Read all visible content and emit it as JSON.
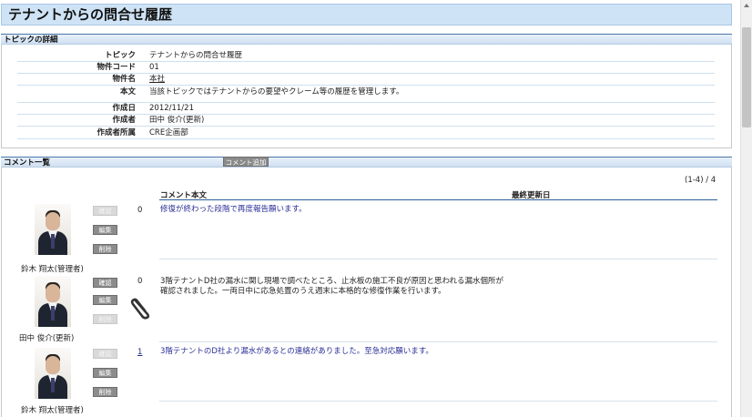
{
  "page_title": "テナントからの問合せ履歴",
  "detail_section": {
    "header": "トピックの詳細",
    "rows": [
      {
        "label": "トピック",
        "value": "テナントからの問合せ履歴"
      },
      {
        "label": "物件コード",
        "value": "01"
      },
      {
        "label": "物件名",
        "value": "本社"
      },
      {
        "label": "本文",
        "value": "当該トピックではテナントからの要望やクレーム等の履歴を管理します。"
      },
      {
        "label": "作成日",
        "value": "2012/11/21"
      },
      {
        "label": "作成者",
        "value": "田中 俊介(更新)"
      },
      {
        "label": "作成者所属",
        "value": "CRE企画部"
      }
    ]
  },
  "comments_section": {
    "header": "コメント一覧",
    "add_button": "コメント追加",
    "count_text": "(1-4) / 4",
    "col_comment": "コメント本文",
    "col_updated": "最終更新日",
    "comments": [
      {
        "author": "鈴木 翔太(管理者)",
        "confirm_label": "確認",
        "edit_label": "編集",
        "delete_label": "削除",
        "count": "0",
        "text": "修復が終わった段階で再度報告願います。"
      },
      {
        "author": "田中 俊介(更新)",
        "confirm_label": "確認",
        "edit_label": "編集",
        "delete_label": "削除",
        "count": "0",
        "text_line1": "3階テナントD社の漏水に関し現場で調べたところ、止水板の施工不良が原因と思われる漏水個所が",
        "text_line2": "確認されました。一両日中に応急処置のうえ週末に本格的な修復作業を行います。"
      },
      {
        "author": "鈴木 翔太(管理者)",
        "confirm_label": "確認",
        "edit_label": "編集",
        "delete_label": "削除",
        "count": "1",
        "text": "3階テナントのD社より漏水があるとの連絡がありました。至急対応願います。"
      }
    ]
  }
}
